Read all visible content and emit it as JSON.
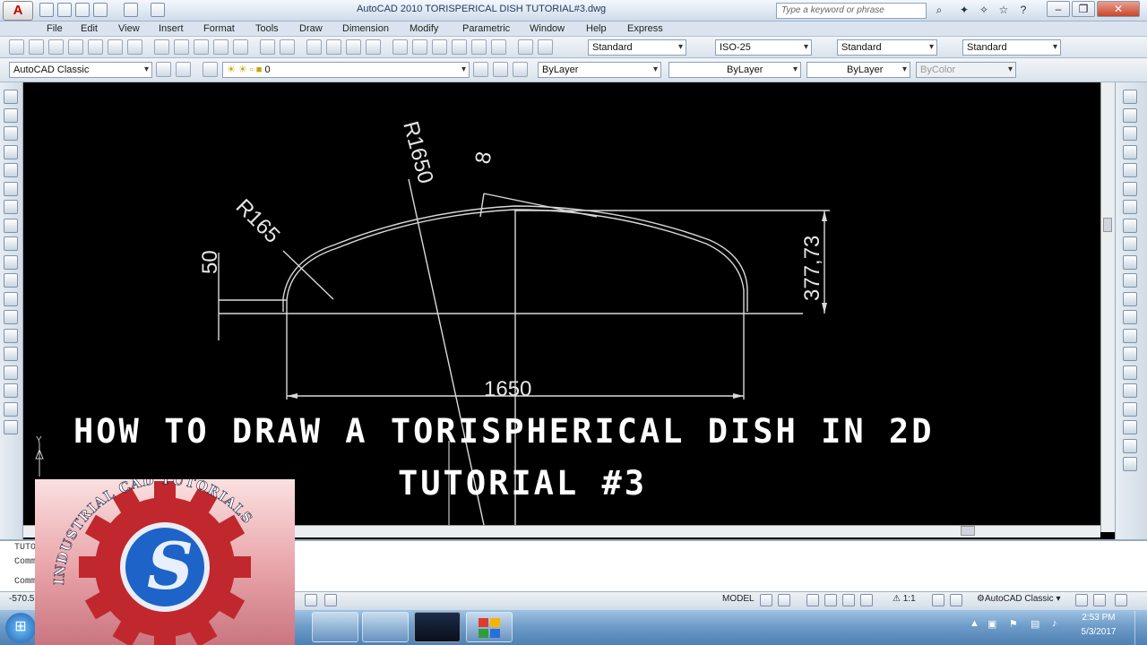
{
  "window": {
    "app_button": "A",
    "title": "AutoCAD 2010       TORISPERICAL DISH TUTORIAL#3.dwg",
    "search_placeholder": "Type a keyword or phrase",
    "minimize": "–",
    "restore": "❐",
    "close": "✕"
  },
  "menu": [
    "File",
    "Edit",
    "View",
    "Insert",
    "Format",
    "Tools",
    "Draw",
    "Dimension",
    "Modify",
    "Parametric",
    "Window",
    "Help",
    "Express"
  ],
  "toolbar1": {
    "text_style": "Standard",
    "dim_style": "ISO-25",
    "table_style": "Standard",
    "mleader_style": "Standard"
  },
  "toolbar2": {
    "workspace": "AutoCAD Classic",
    "layer": "0",
    "color": "ByLayer",
    "linetype": "ByLayer",
    "lineweight": "ByLayer",
    "plotstyle": "ByColor"
  },
  "drawing": {
    "dim_r1650": "R1650",
    "dim_r165": "R165",
    "dim_8": "8",
    "dim_50": "50",
    "dim_height": "377,73",
    "dim_width": "1650"
  },
  "overlay": {
    "line1": "HOW TO DRAW A TORISPHERICAL DISH IN 2D",
    "line2": "TUTORIAL #3"
  },
  "logo": {
    "text": "INDUSTRIAL CAD TUTORIALS",
    "letter": "S",
    "colors": {
      "gear": "#c0282e",
      "disc": "#1e63c8",
      "panel": "#e8a3a8"
    }
  },
  "command": {
    "line1": "TUTO",
    "line2": "Comm",
    "line3": "Comm"
  },
  "status": {
    "coords": "-570.5",
    "model": "MODEL",
    "scale": "1:1",
    "workspace": "AutoCAD Classic"
  },
  "taskbar": {
    "start": "⊞",
    "time": "2:53 PM",
    "date": "5/3/2017"
  }
}
